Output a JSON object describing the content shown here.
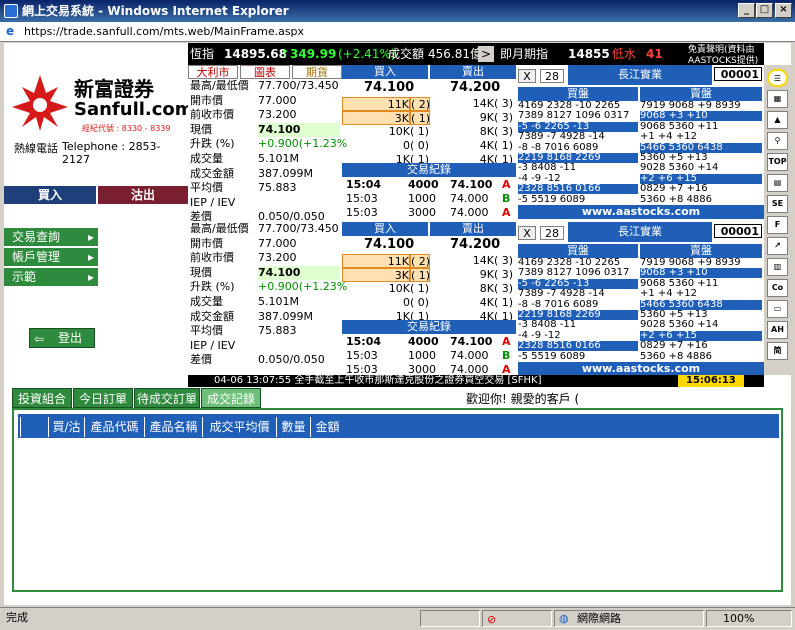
{
  "window": {
    "title": "網上交易系統 - Windows Internet Explorer",
    "url": "https://trade.sanfull.com/mts.web/MainFrame.aspx"
  },
  "brand": {
    "name_cn": "新富證券",
    "name_en": "Sanfull.com",
    "broker_code": "經紀代號 : 8330 - 8339",
    "hotline_label": "熱線電話",
    "hotline": "Telephone : 2853-2127"
  },
  "ticker": {
    "hsi_label": "恆指",
    "hsi": "14895.68",
    "hsi_change": "349.99",
    "hsi_pct": "(+2.41%)",
    "turnover_label": "成交額",
    "turnover": "456.81億",
    "futures_label": "即月期指",
    "futures": "14855",
    "discount_label": "低水",
    "discount": "41",
    "disclaimer1": "免責聲明(資料由",
    "disclaimer2": "AASTOCKS提供)",
    "arrow": ">"
  },
  "quote_tabs": [
    "大利市",
    "圖表",
    "期貨"
  ],
  "quote": {
    "rows": [
      {
        "label": "最高/最低價",
        "value": "77.700/73.450"
      },
      {
        "label": "開市價",
        "value": "77.000"
      },
      {
        "label": "前收市價",
        "value": "73.200"
      },
      {
        "label": "現價",
        "value": "74.100"
      },
      {
        "label": "升跌 (%)",
        "value": "+0.900(+1.23%"
      },
      {
        "label": "成交量",
        "value": "5.101M"
      },
      {
        "label": "成交金額",
        "value": "387.099M"
      },
      {
        "label": "平均價",
        "value": "75.883"
      },
      {
        "label": "IEP / IEV",
        "value": ""
      },
      {
        "label": "差價",
        "value": "0.050/0.050"
      }
    ]
  },
  "orderbook": {
    "buy_label": "買入",
    "sell_label": "賣出",
    "bid": "74.100",
    "ask": "74.200",
    "bids": [
      {
        "qty": "11K",
        "n": "( 2)"
      },
      {
        "qty": "3K",
        "n": "( 1)"
      },
      {
        "qty": "10K",
        "n": "( 1)"
      },
      {
        "qty": "0",
        "n": "( 0)"
      },
      {
        "qty": "1K",
        "n": "( 1)"
      }
    ],
    "asks": [
      {
        "qty": "14K",
        "n": "( 3)"
      },
      {
        "qty": "9K",
        "n": "( 3)"
      },
      {
        "qty": "8K",
        "n": "( 3)"
      },
      {
        "qty": "4K",
        "n": "( 1)"
      },
      {
        "qty": "4K",
        "n": "( 1)"
      }
    ],
    "trade_label": "交易紀錄",
    "trades": [
      {
        "t": "15:04",
        "q": "4000",
        "p": "74.100",
        "s": "A"
      },
      {
        "t": "15:03",
        "q": "1000",
        "p": "74.000",
        "s": "B"
      },
      {
        "t": "15:03",
        "q": "3000",
        "p": "74.000",
        "s": "A"
      }
    ]
  },
  "broker": {
    "close": "X",
    "count": "28",
    "name": "長江實業",
    "code": "00001",
    "buy_label": "買盤",
    "sell_label": "賣盤",
    "buy_rows": [
      "4169 2328 -10 2265",
      "7389 8127 1096 0317",
      "-5 -6 2265 -13",
      "7389 -7 4928 -14",
      "-8 -8 7016 6089",
      "2219 8168 2269",
      "-3 8408 -11",
      "-4 -9 -12",
      "2328 8516 0166",
      "-5 5519 6089"
    ],
    "sell_rows": [
      "7919 9068 +9 8939",
      "9068 +3 +10",
      "9068 5360 +11",
      "+1 +4 +12",
      "5466 5360 6438",
      "5360 +5 +13",
      "9028 5360 +14",
      "+2 +6 +15",
      "0829 +7 +16",
      "5360 +8 4886"
    ],
    "site": "www.aastocks.com"
  },
  "news": {
    "text": "04-06 13:07:55  全手截至上午收市那斯達克股份之證券買空交易 [SFHK]",
    "clock": "15:06:13"
  },
  "nav": {
    "buy": "買入",
    "sell": "沽出",
    "menu": [
      "交易查詢",
      "帳戶管理",
      "示範"
    ],
    "logout": "登出"
  },
  "tabs": [
    "投資組合",
    "今日訂單",
    "待成交訂單",
    "成交記錄"
  ],
  "welcome": "歡迎你! 親愛的客戶 (",
  "table": {
    "headers": [
      "",
      "買/沽",
      "產品代碼",
      "產品名稱",
      "成交平均價",
      "數量",
      "金額"
    ]
  },
  "status": {
    "left": "完成",
    "zone": "網際網路",
    "zoom": "100%"
  },
  "colors": {
    "accent_green": "#2e8b3d",
    "header_blue": "#1f5fb8",
    "up": "#009000",
    "down": "#e00000"
  }
}
